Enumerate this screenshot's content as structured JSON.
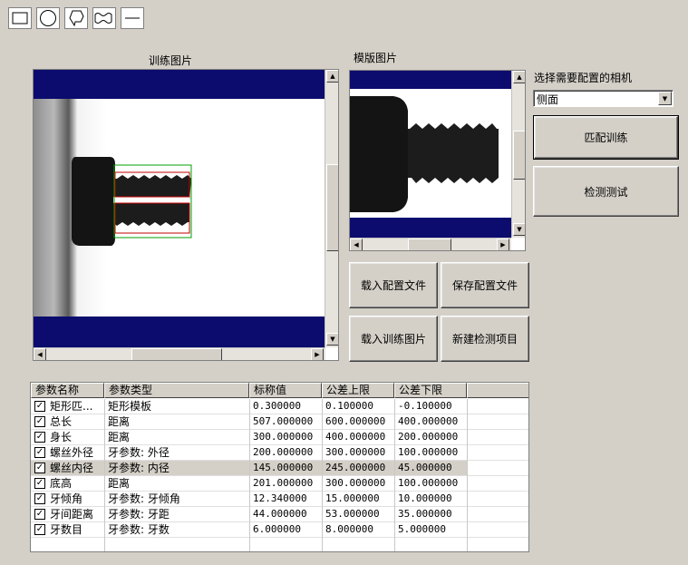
{
  "toolbar": {
    "tools": [
      {
        "icon": "rectangle-tool-icon"
      },
      {
        "icon": "circle-tool-icon"
      },
      {
        "icon": "polygon-tool-icon"
      },
      {
        "icon": "wave-tool-icon"
      },
      {
        "icon": "line-tool-icon"
      }
    ]
  },
  "train_panel": {
    "title": "训练图片"
  },
  "template_panel": {
    "title": "模版图片"
  },
  "camera": {
    "label": "选择需要配置的相机",
    "selected": "侧面"
  },
  "buttons": {
    "match_train": "匹配训练",
    "detect_test": "检测测试",
    "load_config": "载入配置文件",
    "save_config": "保存配置文件",
    "load_train_image": "载入训练图片",
    "new_detect_item": "新建检测项目"
  },
  "table": {
    "headers": [
      "参数名称",
      "参数类型",
      "标称值",
      "公差上限",
      "公差下限"
    ],
    "rows": [
      {
        "name": "矩形匹...",
        "type": "矩形模板",
        "nominal": "0.300000",
        "upper": "0.100000",
        "lower": "-0.100000",
        "checked": true,
        "selected": false
      },
      {
        "name": "总长",
        "type": "距离",
        "nominal": "507.000000",
        "upper": "600.000000",
        "lower": "400.000000",
        "checked": true,
        "selected": false
      },
      {
        "name": "身长",
        "type": "距离",
        "nominal": "300.000000",
        "upper": "400.000000",
        "lower": "200.000000",
        "checked": true,
        "selected": false
      },
      {
        "name": "螺丝外径",
        "type": "牙参数: 外径",
        "nominal": "200.000000",
        "upper": "300.000000",
        "lower": "100.000000",
        "checked": true,
        "selected": false
      },
      {
        "name": "螺丝内径",
        "type": "牙参数: 内径",
        "nominal": "145.000000",
        "upper": "245.000000",
        "lower": "45.000000",
        "checked": true,
        "selected": true
      },
      {
        "name": "底高",
        "type": "距离",
        "nominal": "201.000000",
        "upper": "300.000000",
        "lower": "100.000000",
        "checked": true,
        "selected": false
      },
      {
        "name": "牙倾角",
        "type": "牙参数: 牙倾角",
        "nominal": "12.340000",
        "upper": "15.000000",
        "lower": "10.000000",
        "checked": true,
        "selected": false
      },
      {
        "name": "牙间距离",
        "type": "牙参数: 牙距",
        "nominal": "44.000000",
        "upper": "53.000000",
        "lower": "35.000000",
        "checked": true,
        "selected": false
      },
      {
        "name": "牙数目",
        "type": "牙参数: 牙数",
        "nominal": "6.000000",
        "upper": "8.000000",
        "lower": "5.000000",
        "checked": true,
        "selected": false
      }
    ]
  },
  "colors": {
    "banner": "#0c0c6e",
    "roi_red": "#c00000",
    "roi_green": "#00a000"
  }
}
